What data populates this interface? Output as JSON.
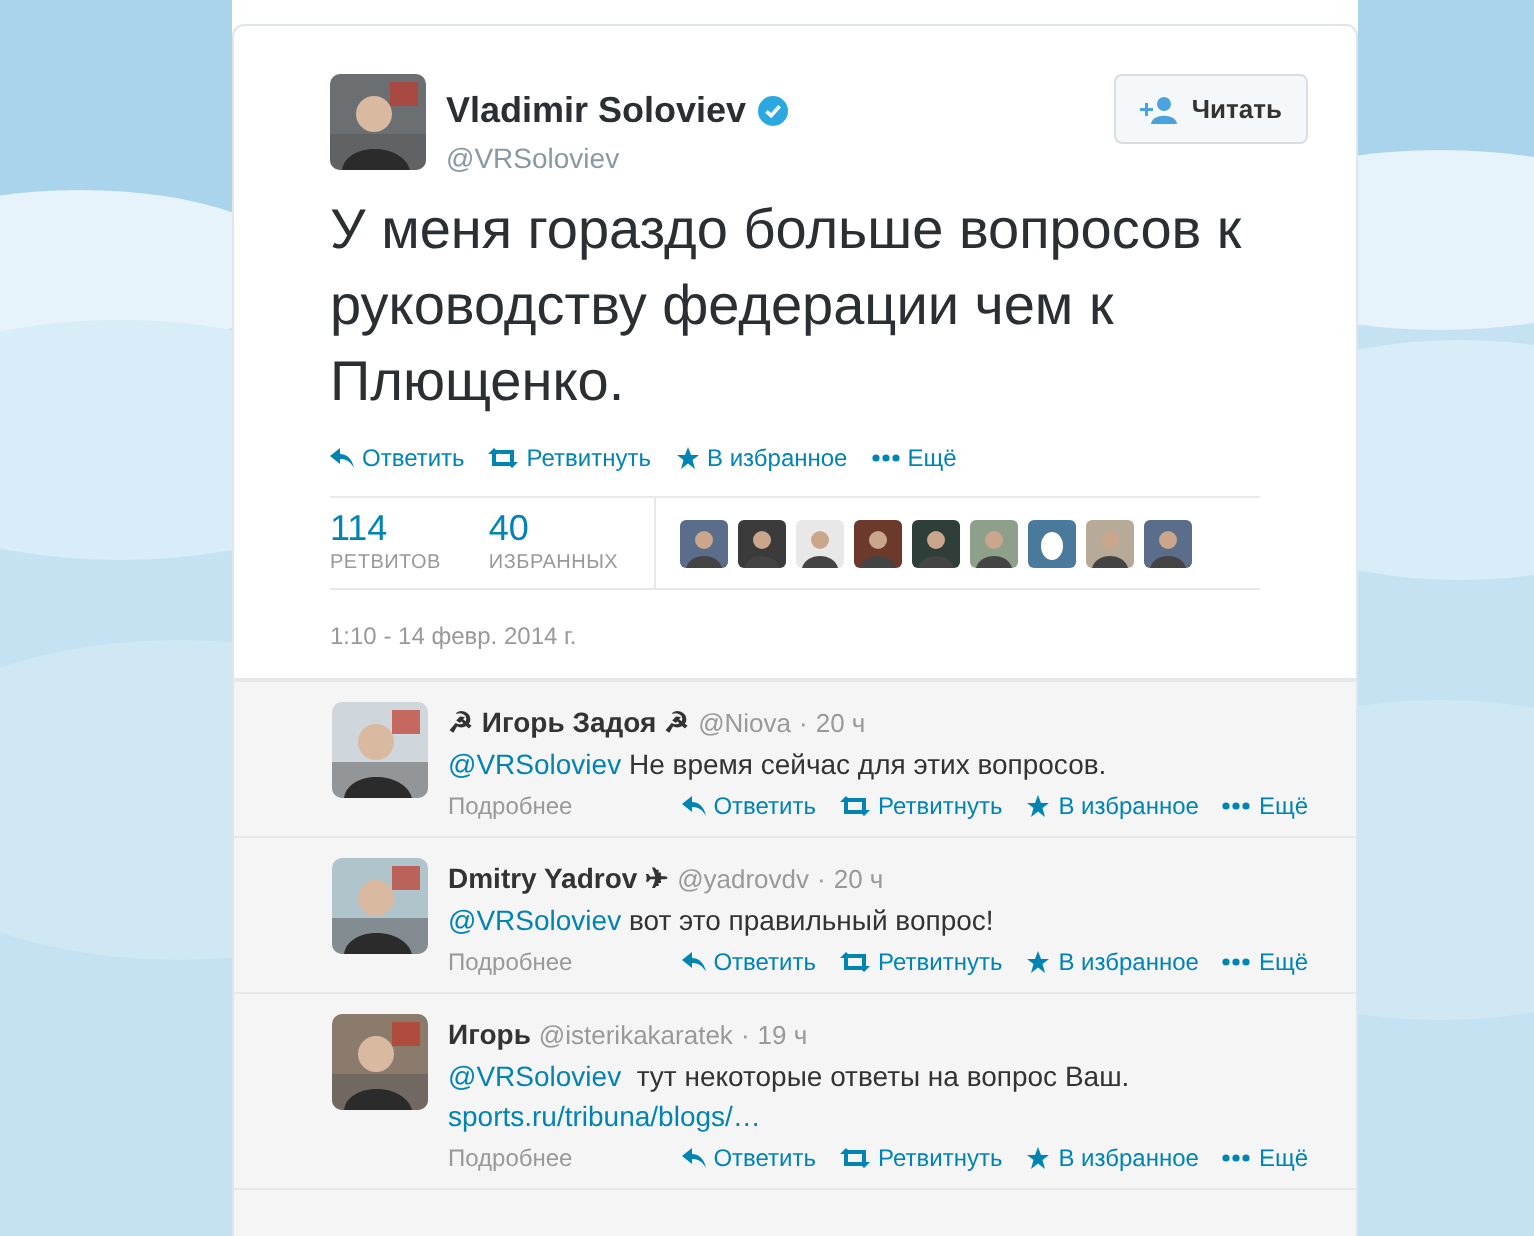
{
  "tweet": {
    "name": "Vladimir Soloviev",
    "verified": true,
    "handle": "@VRSoloviev",
    "follow_button": "Читать",
    "text": "У меня гораздо больше вопросов к руководству федерации чем к Плющенко.",
    "actions": [
      {
        "kind": "reply",
        "label": "Ответить"
      },
      {
        "kind": "retweet",
        "label": "Ретвитнуть"
      },
      {
        "kind": "favorite",
        "label": "В избранное"
      },
      {
        "kind": "more",
        "label": "Ещё"
      }
    ],
    "stats": [
      {
        "value": "114",
        "label": "РЕТВИТОВ"
      },
      {
        "value": "40",
        "label": "ИЗБРАННЫХ"
      }
    ],
    "favoriters": [
      {
        "kind": "picture"
      },
      {
        "kind": "picture"
      },
      {
        "kind": "picture"
      },
      {
        "kind": "picture"
      },
      {
        "kind": "picture"
      },
      {
        "kind": "picture"
      },
      {
        "kind": "egg"
      },
      {
        "kind": "picture"
      },
      {
        "kind": "picture"
      }
    ],
    "date": "1:10 - 14 февр. 2014 г."
  },
  "replies": [
    {
      "name": "☭ Игорь Задоя ☭",
      "handle": "@Niova",
      "separator": "·",
      "time": "20 ч",
      "mention": "@VRSoloviev",
      "text": "Не время сейчас для этих вопросов.",
      "details": "Подробнее",
      "actions": [
        {
          "kind": "reply",
          "label": "Ответить"
        },
        {
          "kind": "retweet",
          "label": "Ретвитнуть"
        },
        {
          "kind": "favorite",
          "label": "В избранное"
        },
        {
          "kind": "more",
          "label": "Ещё"
        }
      ]
    },
    {
      "name": "Dmitry Yadrov ✈",
      "handle": "@yadrovdv",
      "separator": "·",
      "time": "20 ч",
      "mention": "@VRSoloviev",
      "text": "вот это правильный вопрос!",
      "details": "Подробнее",
      "actions": [
        {
          "kind": "reply",
          "label": "Ответить"
        },
        {
          "kind": "retweet",
          "label": "Ретвитнуть"
        },
        {
          "kind": "favorite",
          "label": "В избранное"
        },
        {
          "kind": "more",
          "label": "Ещё"
        }
      ]
    },
    {
      "name": "Игорь",
      "handle": "@isterikakaratek",
      "separator": "·",
      "time": "19 ч",
      "mention": "@VRSoloviev",
      "text": " тут некоторые ответы на вопрос Ваш.",
      "link": "sports.ru/tribuna/blogs/…",
      "details": "Подробнее",
      "actions": [
        {
          "kind": "reply",
          "label": "Ответить"
        },
        {
          "kind": "retweet",
          "label": "Ретвитнуть"
        },
        {
          "kind": "favorite",
          "label": "В избранное"
        },
        {
          "kind": "more",
          "label": "Ещё"
        }
      ]
    }
  ]
}
